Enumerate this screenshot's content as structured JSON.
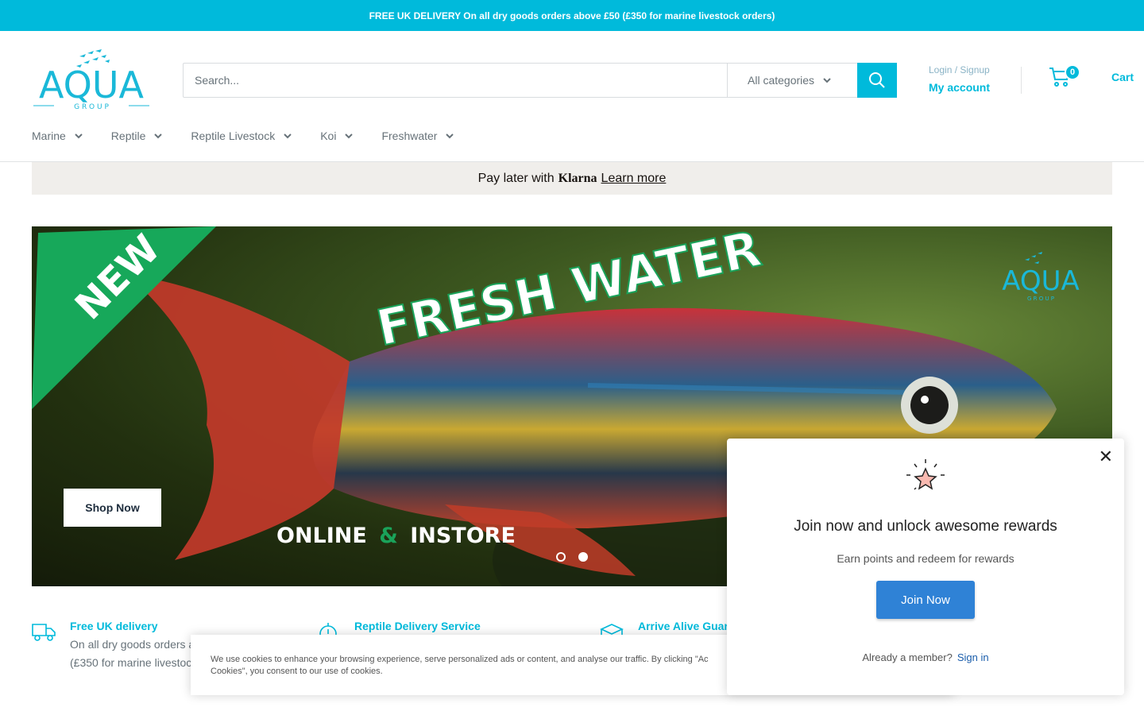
{
  "announcement": "FREE UK DELIVERY On all dry goods orders above £50 (£350 for marine livestock orders)",
  "logo": {
    "name": "AQUA",
    "sub": "G R O U P"
  },
  "search": {
    "placeholder": "Search...",
    "category": "All categories"
  },
  "account": {
    "login": "Login / Signup",
    "my_account": "My account"
  },
  "cart": {
    "count": "0",
    "label": "Cart"
  },
  "nav": [
    {
      "label": "Marine"
    },
    {
      "label": "Reptile"
    },
    {
      "label": "Reptile Livestock"
    },
    {
      "label": "Koi"
    },
    {
      "label": "Freshwater"
    }
  ],
  "klarna": {
    "prefix": "Pay later with",
    "brand": "Klarna",
    "link": "Learn more"
  },
  "hero": {
    "badge": "NEW",
    "headline": "FRESH WATER",
    "tagline_left": "ONLINE",
    "tagline_amp": "&",
    "tagline_right": "INSTORE",
    "logo": "AQUA",
    "logo_sub": "G R O U P",
    "cta": "Shop Now"
  },
  "features": [
    {
      "title": "Free UK delivery",
      "desc1": "On all dry goods orders a",
      "desc2": "(£350 for marine livestoc"
    },
    {
      "title": "Reptile Delivery Service"
    },
    {
      "title": "Arrive Alive Guara"
    }
  ],
  "cookie": {
    "text": "We use cookies to enhance your browsing experience, serve personalized ads or content, and analyse our traffic. By clicking \"Ac",
    "text2": "Cookies\", you consent to our use of cookies."
  },
  "rewards": {
    "title": "Join now and unlock awesome rewards",
    "subtitle": "Earn points and redeem for rewards",
    "button": "Join Now",
    "member": "Already a member?",
    "signin": "Sign in"
  },
  "colors": {
    "accent": "#00badb",
    "join_button": "#2f82d6",
    "klarna_bg": "#f0eeeb"
  }
}
